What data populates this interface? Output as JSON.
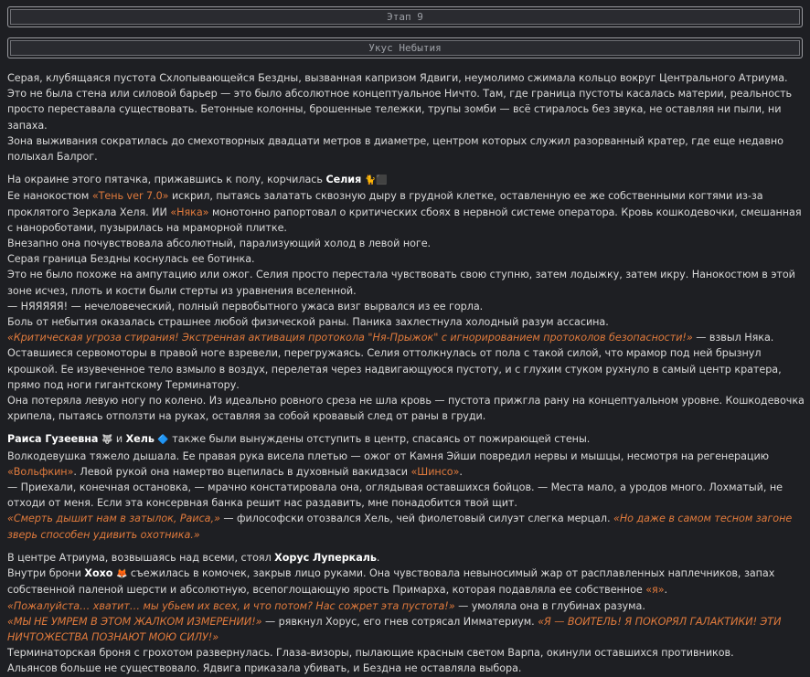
{
  "header": {
    "stage": "Этап 9",
    "chapter": "Укус Небытия"
  },
  "story": {
    "p1a": "Серая, клубящаяся пустота Схлопывающейся Бездны, вызванная капризом Ядвиги, неумолимо сжимала кольцо вокруг Центрального Атриума. Это не была стена или силовой барьер — это было абсолютное концептуальное Ничто. Там, где граница пустоты касалась материи, реальность просто переставала существовать. Бетонные колонны, брошенные тележки, трупы зомби — всё стиралось без звука, не оставляя ни пыли, ни запаха.",
    "p1b": "Зона выживания сократилась до смехотворных двадцати метров в диаметре, центром которых служил разорванный кратер, где еще недавно полыхал Балрог.",
    "p2_intro": "На окраине этого пятачка, прижавшись к полу, корчилась ",
    "celia": "Селия",
    "celia_emoji": "🐈⬛",
    "p3_a": "Ее нанокостюм ",
    "ten": "«Тень ver 7.0»",
    "p3_b": " искрил, пытаясь залатать сквозную дыру в грудной клетке, оставленную ее же собственными когтями из-за проклятого Зеркала Хеля. ИИ ",
    "nyaka": "«Няка»",
    "p3_c": " монотонно рапортовал о критических сбоях в нервной системе оператора. Кровь кошкодевочки, смешанная с нанороботами, пузырилась на мраморной плитке.",
    "l4": "Внезапно она почувствовала абсолютный, парализующий холод в левой ноге.",
    "l5": "Серая граница Бездны коснулась ее ботинка.",
    "l6": "Это не было похоже на ампутацию или ожог. Селия просто перестала чувствовать свою ступню, затем лодыжку, затем икру. Нанокостюм в этой зоне исчез, плоть и кости были стерты из уравнения вселенной.",
    "l7": "— НЯЯЯЯЯ! — нечеловеческий, полный первобытного ужаса визг вырвался из ее горла.",
    "l8": "Боль от небытия оказалась страшнее любой физической раны. Паника захлестнула холодный разум ассасина.",
    "l9_quote": "«Критическая угроза стирания! Экстренная активация протокола \"Ня-Прыжок\" с игнорированием протоколов безопасности!»",
    "l9_tail": " — взвыл Няка.",
    "l10": "Оставшиеся сервомоторы в правой ноге взревели, перегружаясь. Селия оттолкнулась от пола с такой силой, что мрамор под ней брызнул крошкой. Ее изувеченное тело взмыло в воздух, перелетая через надвигающуюся пустоту, и с глухим стуком рухнуло в самый центр кратера, прямо под ноги гигантскому Терминатору.",
    "l11": "Она потеряла левую ногу по колено. Из идеально ровного среза не шла кровь — пустота прижгла рану на концептуальном уровне. Кошкодевочка хрипела, пытаясь отползти на руках, оставляя за собой кровавый след от раны в груди.",
    "raisa": "Раиса Гузеевна",
    "raisa_emoji": "🐺",
    "and": " и ",
    "hel": "Хель",
    "hel_emoji": "🔷",
    "l12_tail": " также были вынуждены отступить в центр, спасаясь от пожирающей стены.",
    "l13_a": "Волкодевушка тяжело дышала. Ее правая рука висела плетью — ожог от Камня Эйши повредил нервы и мышцы, несмотря на регенерацию ",
    "wolfkin": "«Вольфкин»",
    "l13_b": ". Левой рукой она намертво вцепилась в духовный вакидзаси ",
    "shinso": "«Шинсо»",
    "l13_c": ".",
    "l14": "— Приехали, конечная остановка, — мрачно констатировала она, оглядывая оставшихся бойцов. — Места мало, а уродов много. Лохматый, не отходи от меня. Если эта консервная банка решит нас раздавить, мне понадобится твой щит.",
    "l15_q1": "«Смерть дышит нам в затылок, Раиса,»",
    "l15_mid": " — философски отозвался Хель, чей фиолетовый силуэт слегка мерцал. ",
    "l15_q2": "«Но даже в самом тесном загоне зверь способен удивить охотника.»",
    "l16_a": "В центре Атриума, возвышаясь над всеми, стоял ",
    "horus": "Хорус Луперкаль",
    "l16_b": ".",
    "l17_a": "Внутри брони ",
    "hoho": "Хохо",
    "hoho_emoji": "🦊",
    "l17_b": " съежилась в комочек, закрыв лицо руками. Она чувствовала невыносимый жар от расплавленных наплечников, запах собственной паленой шерсти и абсолютную, всепоглощающую ярость Примарха, которая подавляла ее собственное ",
    "ya": "«я»",
    "l17_c": ".",
    "l18_q": "«Пожалуйста… хватит… мы убьем их всех, и что потом? Нас сожрет эта пустота!»",
    "l18_tail": " — умоляла она в глубинах разума.",
    "l19_q1": "«МЫ НЕ УМРЕМ В ЭТОМ ЖАЛКОМ ИЗМЕРЕНИИ!»",
    "l19_mid": " — рявкнул Хорус, его гнев сотрясал Имматериум. ",
    "l19_q2": "«Я — ВОИТЕЛЬ! Я ПОКОРЯЛ ГАЛАКТИКИ! ЭТИ НИЧТОЖЕСТВА ПОЗНАЮТ МОЮ СИЛУ!»",
    "l20": "Терминаторская броня с грохотом развернулась. Глаза-визоры, пылающие красным светом Варпа, окинули оставшихся противников.",
    "l21": "Альянсов больше не существовало. Ядвига приказала убивать, и Бездна не оставляла выбора."
  },
  "colors": {
    "background": "#1e1f23",
    "text": "#d9d9d9",
    "accent": "#e07a3c"
  }
}
